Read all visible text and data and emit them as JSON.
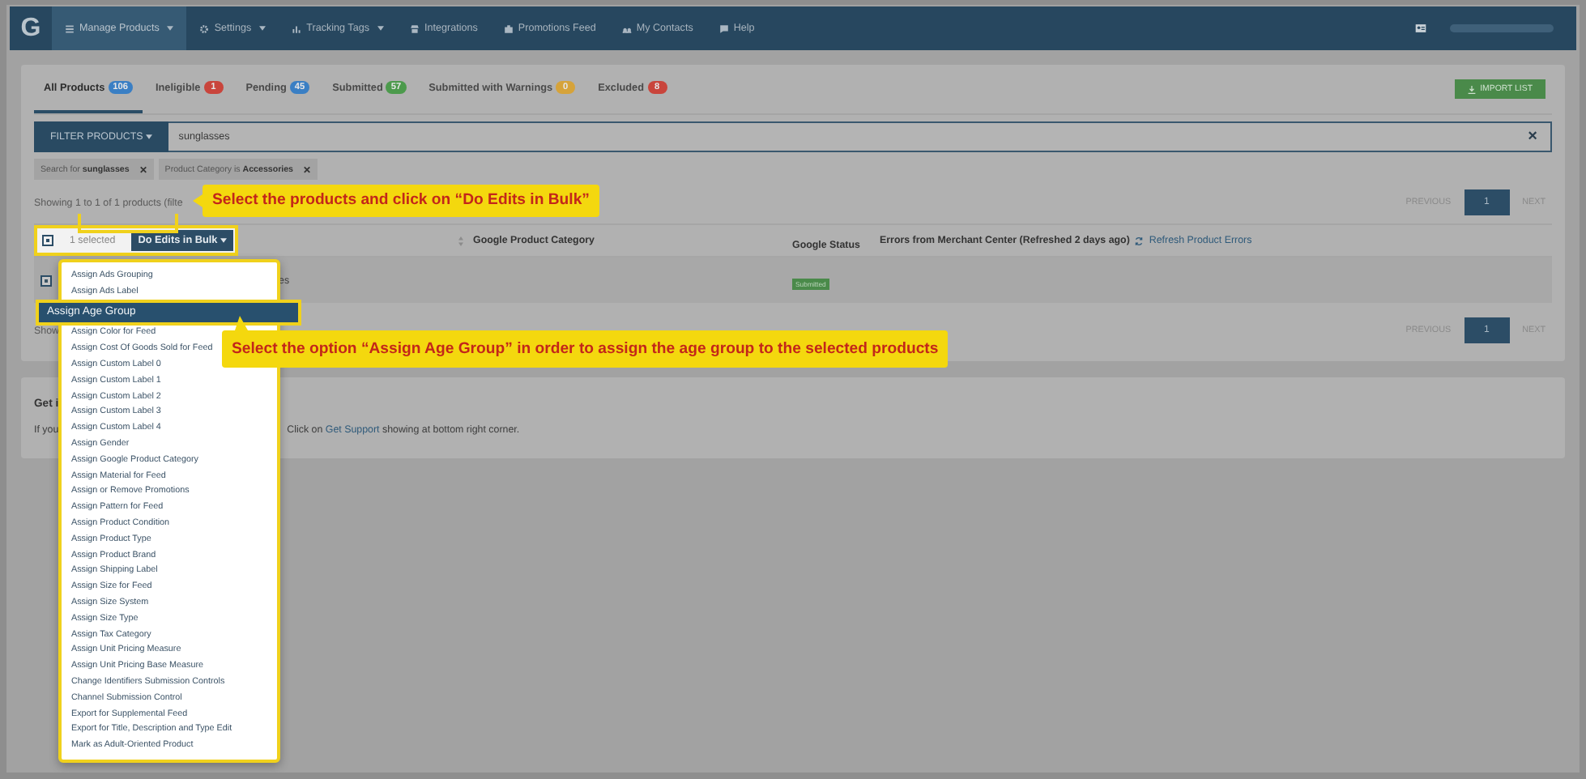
{
  "nav": {
    "logo": "G",
    "items": [
      {
        "label": "Manage Products",
        "dropdown": true,
        "selected": true
      },
      {
        "label": "Settings",
        "dropdown": true,
        "selected": false
      },
      {
        "label": "Tracking Tags",
        "dropdown": true,
        "selected": false
      },
      {
        "label": "Integrations",
        "dropdown": false,
        "selected": false
      },
      {
        "label": "Promotions Feed",
        "dropdown": false,
        "selected": false
      },
      {
        "label": "My Contacts",
        "dropdown": false,
        "selected": false
      },
      {
        "label": "Help",
        "dropdown": false,
        "selected": false
      }
    ]
  },
  "tabs": [
    {
      "label": "All Products",
      "count": "106",
      "color": "#3a7fc4",
      "selected": true
    },
    {
      "label": "Ineligible",
      "count": "1",
      "color": "#c9453c",
      "selected": false
    },
    {
      "label": "Pending",
      "count": "45",
      "color": "#3a7fc4",
      "selected": false
    },
    {
      "label": "Submitted",
      "count": "57",
      "color": "#4c9a4c",
      "selected": false
    },
    {
      "label": "Submitted with Warnings",
      "count": "0",
      "color": "#d6a33a",
      "selected": false
    },
    {
      "label": "Excluded",
      "count": "8",
      "color": "#c9453c",
      "selected": false
    }
  ],
  "import_button": "IMPORT LIST",
  "filter": {
    "button": "FILTER PRODUCTS",
    "value": "sunglasses",
    "clear": "×"
  },
  "chips": [
    {
      "text": "Search for **sunglasses**",
      "remove": "✕"
    },
    {
      "text": "Product Category is **Accessories**",
      "remove": "✕"
    }
  ],
  "showing_top": "Showing 1 to 1 of 1 products (filte",
  "showing_bottom": "Show",
  "pagination_top": {
    "previous": "PREVIOUS",
    "pages": [
      {
        "label": "1",
        "selected": true
      }
    ],
    "next": "NEXT"
  },
  "pagination_bottom": {
    "previous": "PREVIOUS",
    "pages": [
      {
        "label": "1",
        "selected": true
      }
    ],
    "next": "NEXT"
  },
  "table": {
    "selection": {
      "checked": true,
      "count": "1 selected",
      "bulk_button": "Do Edits in Bulk"
    },
    "columns": [
      "Google Product Category",
      "Google Status",
      "Errors from Merchant Center (Refreshed 2 days ago)"
    ],
    "refresh_link": "Refresh Product Errors",
    "rows": [
      {
        "checked": true,
        "product": "es",
        "status": "Submitted"
      }
    ]
  },
  "bulk_menu": [
    {
      "label": "Assign Ads Grouping",
      "selected": false
    },
    {
      "label": "Assign Ads Label",
      "selected": false
    },
    {
      "label": "Assign Age Group",
      "selected": true
    },
    {
      "label": "Assign Color for Feed",
      "selected": false
    },
    {
      "label": "Assign Cost Of Goods Sold for Feed",
      "selected": false
    },
    {
      "label": "Assign Custom Label 0",
      "selected": false
    },
    {
      "label": "Assign Custom Label 1",
      "selected": false
    },
    {
      "label": "Assign Custom Label 2",
      "selected": false
    },
    {
      "label": "Assign Custom Label 3",
      "selected": false
    },
    {
      "label": "Assign Custom Label 4",
      "selected": false
    },
    {
      "label": "Assign Gender",
      "selected": false
    },
    {
      "label": "Assign Google Product Category",
      "selected": false
    },
    {
      "label": "Assign Material for Feed",
      "selected": false
    },
    {
      "label": "Assign or Remove Promotions",
      "selected": false
    },
    {
      "label": "Assign Pattern for Feed",
      "selected": false
    },
    {
      "label": "Assign Product Condition",
      "selected": false
    },
    {
      "label": "Assign Product Type",
      "selected": false
    },
    {
      "label": "Assign Product Brand",
      "selected": false
    },
    {
      "label": "Assign Shipping Label",
      "selected": false
    },
    {
      "label": "Assign Size for Feed",
      "selected": false
    },
    {
      "label": "Assign Size System",
      "selected": false
    },
    {
      "label": "Assign Size Type",
      "selected": false
    },
    {
      "label": "Assign Tax Category",
      "selected": false
    },
    {
      "label": "Assign Unit Pricing Measure",
      "selected": false
    },
    {
      "label": "Assign Unit Pricing Base Measure",
      "selected": false
    },
    {
      "label": "Change Identifiers Submission Controls",
      "selected": false
    },
    {
      "label": "Channel Submission Control",
      "selected": false
    },
    {
      "label": "Export for Supplemental Feed",
      "selected": false
    },
    {
      "label": "Export for Title, Description and Type Edit",
      "selected": false
    },
    {
      "label": "Mark as Adult-Oriented Product",
      "selected": false
    }
  ],
  "help": {
    "heading": "Get i",
    "text_start": "If you",
    "text_end_before": "Click on",
    "link": "Get Support",
    "text_end_after": "showing at bottom right corner."
  },
  "callouts": [
    "Select the products and click on “Do Edits in Bulk”",
    "Select the option “Assign Age Group” in order to assign the age group to the selected products"
  ]
}
